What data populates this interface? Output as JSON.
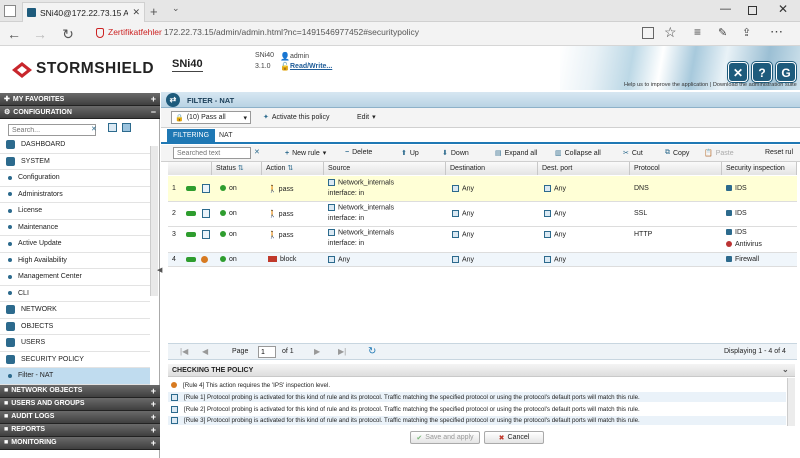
{
  "browser": {
    "tab_title": "SNi40@172.22.73.15 Ac",
    "cert_warning": "Zertifikatfehler",
    "url": "172.22.73.15/admin/admin.html?nc=1491546977452#securitypolicy"
  },
  "header": {
    "brand": "STORMSHIELD",
    "model": "SNi40",
    "device_name": "SNi40",
    "version": "3.1.0",
    "user": "admin",
    "access_mode": "Read/Write...",
    "help_link": "Help us to improve the application",
    "download_link": "Download the administration suite",
    "colors": {
      "brand": "#1e5b7c",
      "accent": "#1f78b4"
    }
  },
  "sidebar": {
    "favorites": "MY FAVORITES",
    "configuration": "CONFIGURATION",
    "search_placeholder": "Search...",
    "dashboard": "DASHBOARD",
    "system": "SYSTEM",
    "system_items": [
      "Configuration",
      "Administrators",
      "License",
      "Maintenance",
      "Active Update",
      "High Availability",
      "Management Center",
      "CLI"
    ],
    "network": "NETWORK",
    "objects": "OBJECTS",
    "users": "USERS",
    "security_policy": "SECURITY POLICY",
    "filter_nat": "Filter - NAT",
    "sections": [
      "NETWORK OBJECTS",
      "USERS AND GROUPS",
      "AUDIT LOGS",
      "REPORTS",
      "MONITORING"
    ]
  },
  "panel": {
    "title": "FILTER - NAT",
    "policy_select": "(10) Pass all",
    "activate": "Activate this policy",
    "edit": "Edit",
    "tabs": [
      "FILTERING",
      "NAT"
    ],
    "search_placeholder": "Searched text",
    "toolbar": {
      "new_rule": "New rule",
      "delete": "Delete",
      "up": "Up",
      "down": "Down",
      "expand_all": "Expand all",
      "collapse_all": "Collapse all",
      "cut": "Cut",
      "copy": "Copy",
      "paste": "Paste",
      "reset": "Reset rul"
    }
  },
  "table": {
    "columns": [
      "Status",
      "Action",
      "Source",
      "Destination",
      "Dest. port",
      "Protocol",
      "Security inspection"
    ],
    "rows": [
      {
        "num": "1",
        "status": "on",
        "action": "pass",
        "source": "Network_internals",
        "source_if": "interface: in",
        "destination": "Any",
        "dest_port": "Any",
        "protocol": "DNS",
        "inspection": "IDS",
        "inspection2": ""
      },
      {
        "num": "2",
        "status": "on",
        "action": "pass",
        "source": "Network_internals",
        "source_if": "interface: in",
        "destination": "Any",
        "dest_port": "Any",
        "protocol": "SSL",
        "inspection": "IDS",
        "inspection2": ""
      },
      {
        "num": "3",
        "status": "on",
        "action": "pass",
        "source": "Network_internals",
        "source_if": "interface: in",
        "destination": "Any",
        "dest_port": "Any",
        "protocol": "HTTP",
        "inspection": "IDS",
        "inspection2": "Antivirus"
      },
      {
        "num": "4",
        "status": "on",
        "action": "block",
        "source": "Any",
        "source_if": "",
        "destination": "Any",
        "dest_port": "Any",
        "protocol": "",
        "inspection": "Firewall",
        "inspection2": ""
      }
    ]
  },
  "pager": {
    "page_label": "Page",
    "page_value": "1",
    "of_label": "of 1",
    "displaying": "Displaying 1 - 4 of 4"
  },
  "checking": {
    "title": "CHECKING THE POLICY",
    "messages": [
      "[Rule 4] This action requires the 'IPS' inspection level.",
      "[Rule 1] Protocol probing is activated for this kind of rule and its protocol. Traffic matching the specified protocol or using the protocol's default ports will match this rule.",
      "[Rule 2] Protocol probing is activated for this kind of rule and its protocol. Traffic matching the specified protocol or using the protocol's default ports will match this rule.",
      "[Rule 3] Protocol probing is activated for this kind of rule and its protocol. Traffic matching the specified protocol or using the protocol's default ports will match this rule."
    ]
  },
  "footer": {
    "save": "Save and apply",
    "cancel": "Cancel"
  }
}
